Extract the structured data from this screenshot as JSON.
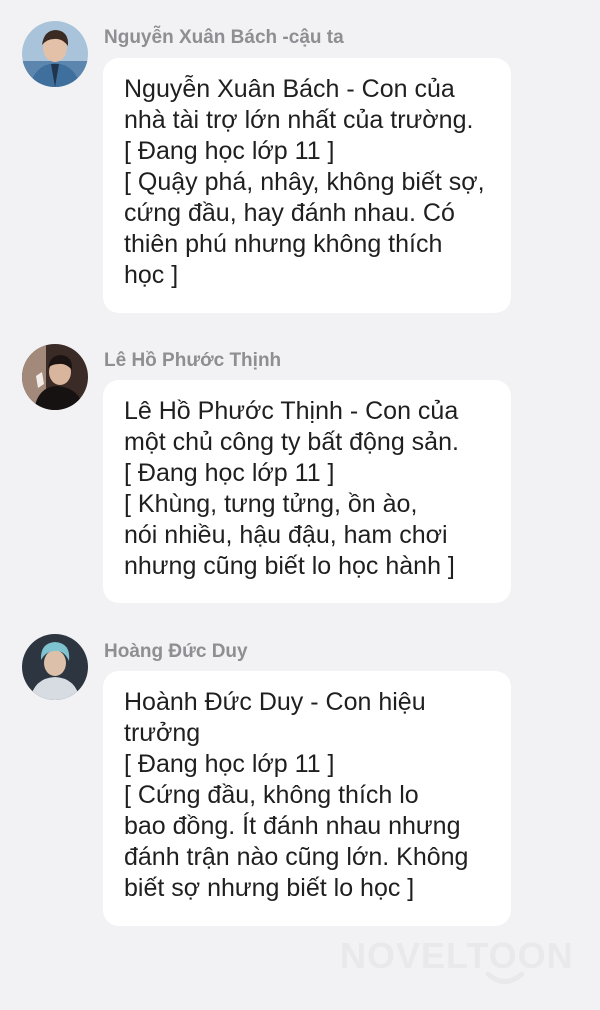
{
  "messages": [
    {
      "sender": "Nguyễn Xuân Bách -cậu ta",
      "lines": [
        "Nguyễn Xuân Bách - Con của",
        "nhà tài trợ lớn nhất của trường.",
        "[ Đang học lớp 11 ]",
        "[ Quậy phá, nhây, không biết sợ,",
        "cứng đầu, hay đánh nhau. Có",
        "thiên phú nhưng không thích",
        "học ]"
      ]
    },
    {
      "sender": "Lê Hồ Phước Thịnh",
      "lines": [
        "Lê Hồ Phước Thịnh - Con của",
        "một chủ công ty bất động sản.",
        "[ Đang học lớp 11 ]",
        "[ Khùng, tưng tửng, ồn ào,",
        "nói nhiều, hậu đậu, ham chơi",
        "nhưng cũng biết lo học hành ]"
      ]
    },
    {
      "sender": "Hoàng Đức Duy",
      "lines": [
        "Hoành Đức Duy - Con hiệu",
        "trưởng",
        "[ Đang học lớp 11 ]",
        "[ Cứng đầu, không thích lo",
        "bao đồng. Ít đánh nhau nhưng",
        "đánh trận nào cũng lớn. Không",
        "biết sợ nhưng biết lo học ]"
      ]
    }
  ],
  "watermark": {
    "text": "NOVELTOON",
    "color": "#e9e9ec"
  },
  "colors": {
    "background": "#f2f2f4",
    "bubble": "#ffffff",
    "sender_name": "#8e8e93",
    "message_text": "#1f1f1f"
  }
}
